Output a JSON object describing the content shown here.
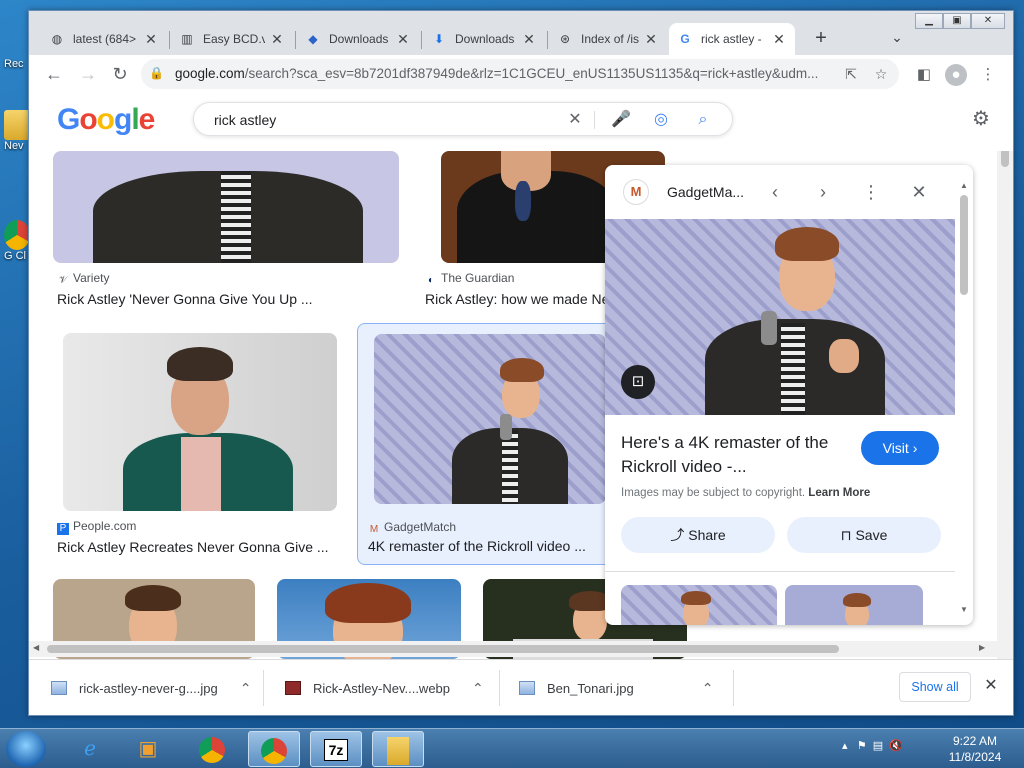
{
  "desktop": {
    "icons": [
      {
        "label": "Rec",
        "icon": "recycle-bin-icon"
      },
      {
        "label": "Nev",
        "icon": "folder-icon"
      },
      {
        "label": "G\nCl",
        "icon": "chrome-icon"
      }
    ]
  },
  "tabs": [
    {
      "title": "latest (684>",
      "icon": "globe-icon",
      "glyph": "◍"
    },
    {
      "title": "Easy BCD.v",
      "icon": "archive-icon",
      "glyph": "▥"
    },
    {
      "title": "Downloads",
      "icon": "downloads-site-icon",
      "glyph": "◆"
    },
    {
      "title": "Downloads",
      "icon": "download-arrow-icon",
      "glyph": "⬇"
    },
    {
      "title": "Index of /is",
      "icon": "index-icon",
      "glyph": "⊛"
    },
    {
      "title": "rick astley -",
      "icon": "google-icon",
      "glyph": "G"
    }
  ],
  "toolbar": {
    "url_host": "google.com",
    "url_rest": "/search?sca_esv=8b7201df387949de&rlz=1C1GCEU_enUS1135US1135&q=rick+astley&udm..."
  },
  "search": {
    "query": "rick astley",
    "logo": "Google"
  },
  "results": [
    {
      "source": "Variety",
      "caption": "Rick Astley 'Never Gonna Give You Up ..."
    },
    {
      "source": "The Guardian",
      "caption": "Rick Astley: how we made Ne"
    },
    {
      "source": "People.com",
      "caption": "Rick Astley Recreates Never Gonna Give ..."
    },
    {
      "source": "GadgetMatch",
      "caption": "4K remaster of the Rickroll video ..."
    }
  ],
  "panel": {
    "site": "GadgetMa...",
    "title": "Here's a 4K remaster of the Rickroll video -...",
    "visit": "Visit",
    "copyright": "Images may be subject to copyright.",
    "learn_more": "Learn More",
    "share": "Share",
    "save": "Save"
  },
  "downloads": [
    {
      "name": "rick-astley-never-g....jpg"
    },
    {
      "name": "Rick-Astley-Nev....webp"
    },
    {
      "name": "Ben_Tonari.jpg"
    }
  ],
  "downloads_show_all": "Show all",
  "taskbar": {
    "time": "9:22 AM",
    "date": "11/8/2024"
  },
  "colors": {
    "accent": "#1a73e8",
    "selected_bg": "#e8f0fe"
  }
}
